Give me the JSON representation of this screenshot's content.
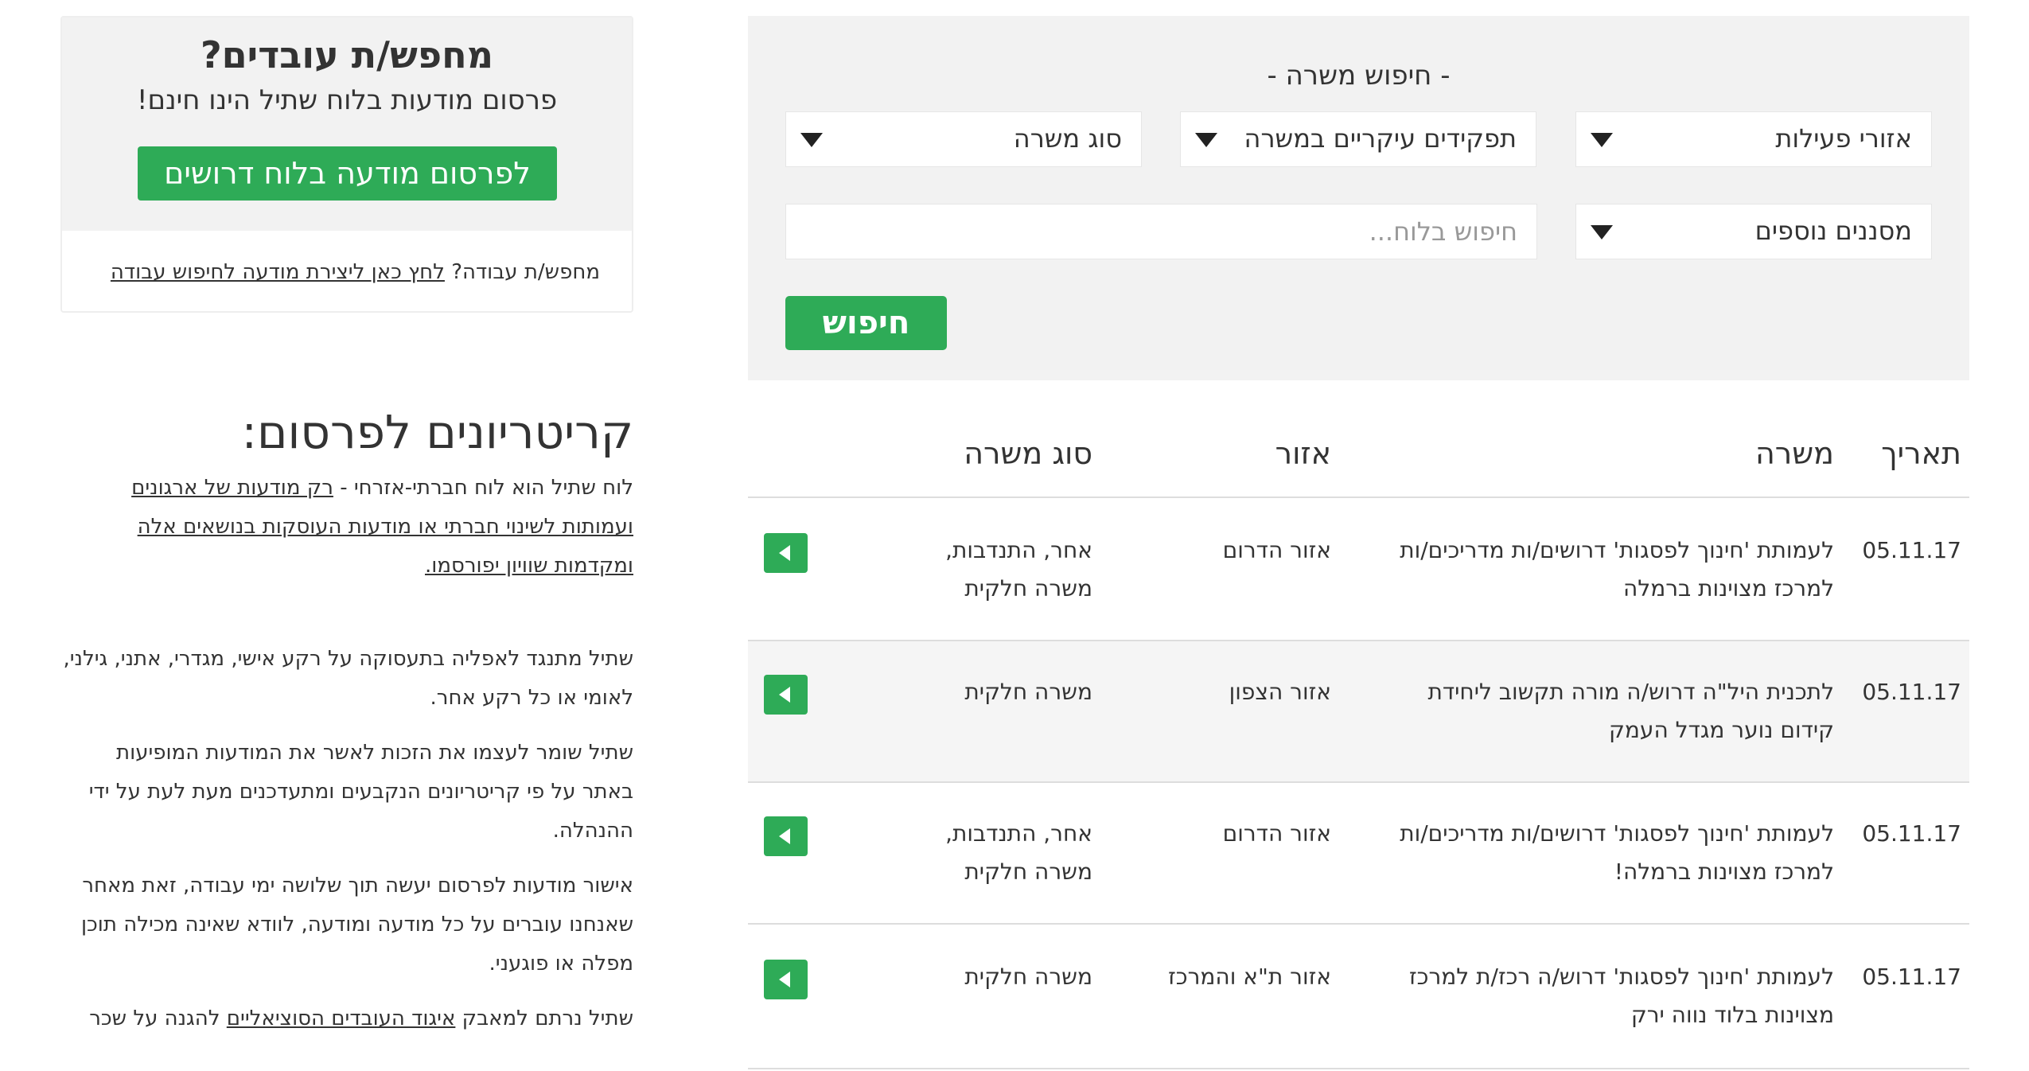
{
  "search": {
    "title": "- חיפוש משרה -",
    "areas_label": "אזורי פעילות",
    "roles_label": "תפקידים עיקריים במשרה",
    "type_label": "סוג משרה",
    "filters_label": "מסננים נוספים",
    "search_placeholder": "חיפוש בלוח...",
    "search_button": "חיפוש"
  },
  "table": {
    "headers": {
      "date": "תאריך",
      "job": "משרה",
      "area": "אזור",
      "type": "סוג משרה"
    },
    "rows": [
      {
        "date": "05.11.17",
        "job": "לעמותת 'חינוך לפסגות' דרושים/ות מדריכים/ות למרכז מצוינות ברמלה",
        "area": "אזור הדרום",
        "type": "אחר, התנדבות, משרה חלקית"
      },
      {
        "date": "05.11.17",
        "job": "לתכנית היל\"ה דרוש/ה מורה תקשוב ליחידת קידום נוער מגדל העמק",
        "area": "אזור הצפון",
        "type": "משרה חלקית"
      },
      {
        "date": "05.11.17",
        "job": "לעמותת 'חינוך לפסגות' דרושים/ות מדריכים/ות למרכז מצוינות ברמלה!",
        "area": "אזור הדרום",
        "type": "אחר, התנדבות, משרה חלקית"
      },
      {
        "date": "05.11.17",
        "job": "לעמותת 'חינוך לפסגות' דרוש/ה רכז/ת למרכז מצוינות בלוד נווה ירק",
        "area": "אזור ת\"א והמרכז",
        "type": "משרה חלקית"
      }
    ]
  },
  "employers": {
    "title": "מחפש/ת עובדים?",
    "subtitle": "פרסום מודעות בלוח שתיל הינו חינם!",
    "publish_button": "לפרסום מודעה בלוח דרושים",
    "seek_prefix": "מחפש/ת עבודה?",
    "seek_link": "לחץ כאן ליצירת מודעה לחיפוש עבודה"
  },
  "criteria": {
    "title": "קריטריונים לפרסום:",
    "p1_prefix": "לוח שתיל הוא לוח חברתי-אזרחי - ",
    "p1_link": "רק מודעות של ארגונים ועמותות לשינוי חברתי או מודעות העוסקות בנושאים אלה ומקדמות שוויון יפורסמו.",
    "p2": "שתיל מתנגד לאפליה בתעסוקה על רקע אישי, מגדרי, אתני, גילני, לאומי או כל רקע אחר.",
    "p3": "שתיל שומר לעצמו את הזכות לאשר את המודעות המופיעות באתר על פי קריטריונים הנקבעים ומתעדכנים מעת לעת על ידי ההנהלה.",
    "p4": "אישור מודעות לפרסום יעשה תוך שלושה ימי עבודה, זאת מאחר שאנחנו עוברים על כל מודעה ומודעה, לוודא שאינה מכילה תוכן מפלה או פוגעני.",
    "p5_prefix": "שתיל נרתם למאבק ",
    "p5_link": "איגוד העובדים הסוציאליים",
    "p5_suffix": " להגנה על שכר"
  }
}
